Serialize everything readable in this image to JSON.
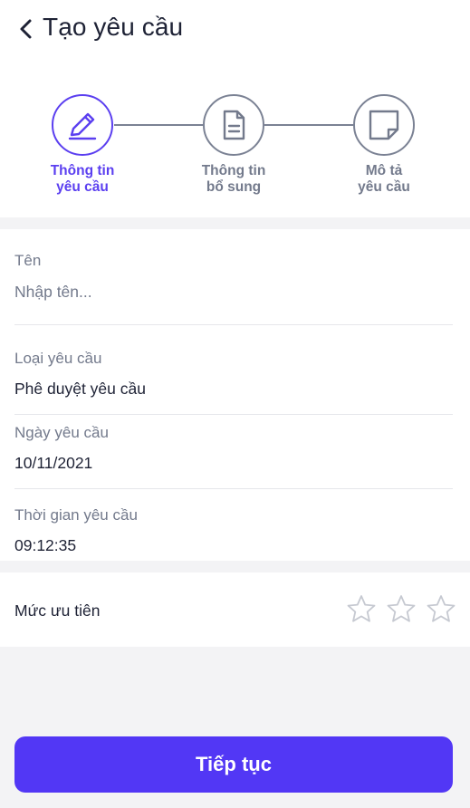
{
  "header": {
    "title": "Tạo yêu cầu"
  },
  "steps": [
    {
      "label": "Thông tin\nyêu cầu",
      "icon": "pencil-icon",
      "active": true
    },
    {
      "label": "Thông tin\nbổ sung",
      "icon": "document-icon",
      "active": false
    },
    {
      "label": "Mô tả\nyêu cầu",
      "icon": "note-icon",
      "active": false
    }
  ],
  "form": {
    "name": {
      "label": "Tên",
      "placeholder": "Nhập tên..."
    },
    "type": {
      "label": "Loại yêu cầu",
      "value": "Phê duyệt yêu cầu"
    },
    "date": {
      "label": "Ngày yêu cầu",
      "value": "10/11/2021"
    },
    "time": {
      "label": "Thời gian yêu cầu",
      "value": "09:12:35"
    }
  },
  "priority": {
    "label": "Mức ưu tiên",
    "rating": 0,
    "max": 3
  },
  "continue_label": "Tiếp tục",
  "colors": {
    "accent": "#5237f5",
    "active_step": "#5b3ff0",
    "muted": "#737a8c"
  }
}
